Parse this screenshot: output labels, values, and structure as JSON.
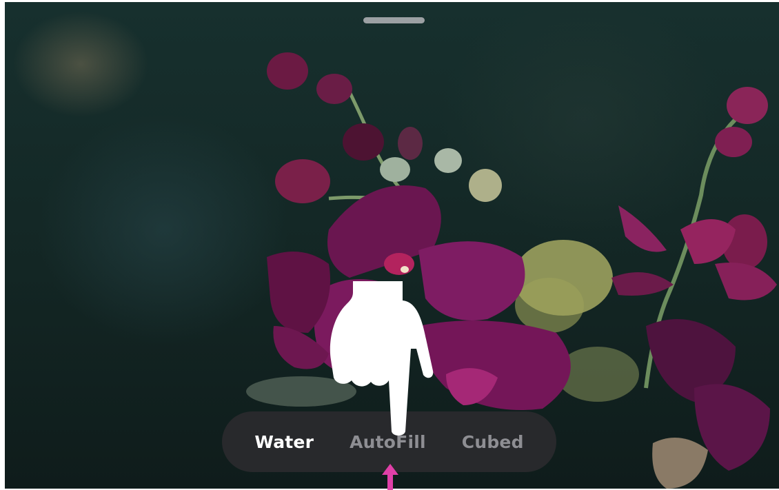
{
  "modes": {
    "items": [
      {
        "label": "Water",
        "active": true
      },
      {
        "label": "AutoFill",
        "active": false
      },
      {
        "label": "Cubed",
        "active": false
      }
    ],
    "active_color": "#ffffff",
    "inactive_color": "#8e8e93"
  },
  "pointer": {
    "icon": "pointing-hand-icon",
    "color": "#ffffff"
  },
  "marker": {
    "icon": "arrow-up-icon",
    "color": "#e040a8"
  },
  "photo": {
    "subject_icon": "orchid-photo",
    "accent": "#7b1a5e"
  }
}
